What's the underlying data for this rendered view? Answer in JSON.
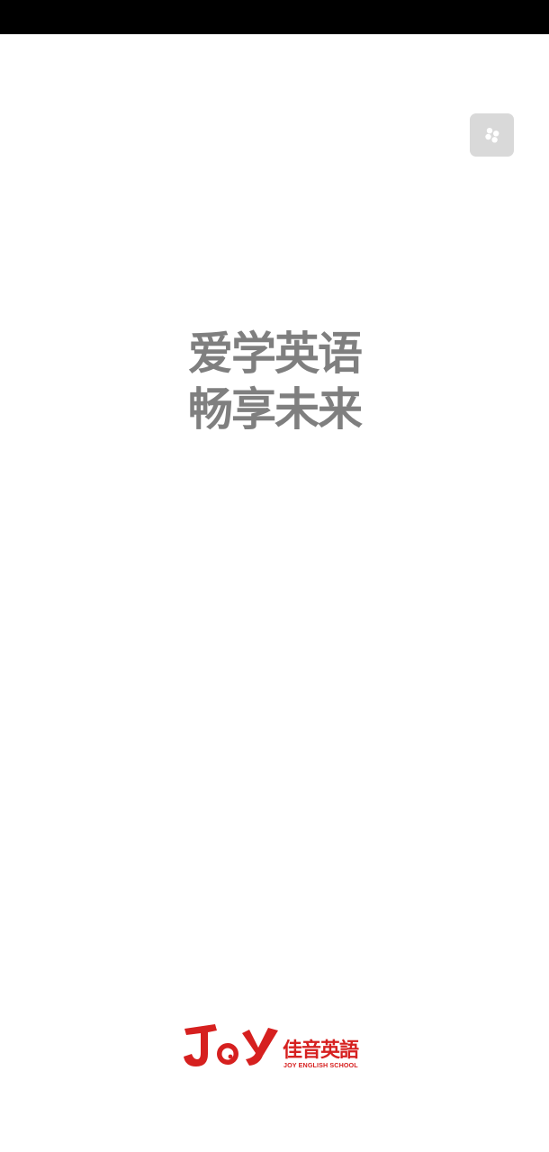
{
  "splash": {
    "slogan_line1": "爱学英语",
    "slogan_line2": "畅享未来",
    "text_color": "#7f7f7f"
  },
  "corner_button": {
    "icon": "dots-cluster-icon",
    "background": "#d9d9d9"
  },
  "brand": {
    "logo_text": "JOY",
    "name": "佳音英語",
    "subtitle": "JOY ENGLISH SCHOOL",
    "color": "#d6201f"
  },
  "status_bar": {
    "background": "#000000"
  }
}
